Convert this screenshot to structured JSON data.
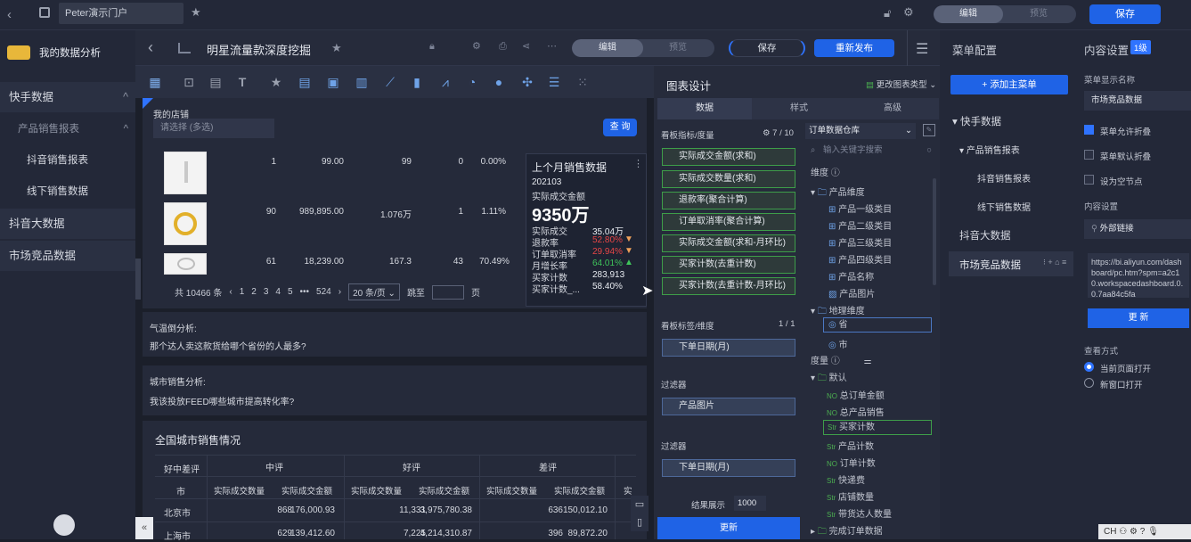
{
  "topbar": {
    "portal_name": "Peter演示门户",
    "mode_edit": "编辑",
    "mode_preview": "预览",
    "save": "保存"
  },
  "sidebar": {
    "title": "我的数据分析",
    "items": [
      {
        "label": "快手数据"
      },
      {
        "label": "产品销售报表"
      },
      {
        "label": "抖音销售报表"
      },
      {
        "label": "线下销售数据"
      },
      {
        "label": "抖音大数据"
      },
      {
        "label": "市场竞品数据"
      }
    ]
  },
  "dashboard": {
    "title": "明星流量款深度挖掘",
    "mode_edit": "编辑",
    "mode_preview": "预览",
    "save": "保存",
    "republish": "重新发布"
  },
  "filter": {
    "label": "我的店铺",
    "placeholder": "请选择 (多选)",
    "query": "查 询"
  },
  "products": [
    {
      "qty": "1",
      "amount": "99.00",
      "count": "99",
      "a": "0",
      "rate": "0.00%"
    },
    {
      "qty": "90",
      "amount": "989,895.00",
      "count": "1.076万",
      "a": "1",
      "rate": "1.11%"
    },
    {
      "qty": "61",
      "amount": "18,239.00",
      "count": "167.3",
      "a": "43",
      "rate": "70.49%"
    }
  ],
  "pager": {
    "total": "共 10466 条",
    "pages": [
      "1",
      "2",
      "3",
      "4",
      "5",
      "•••",
      "524"
    ],
    "per_page": "20 条/页",
    "jump": "跳至",
    "page_unit": "页"
  },
  "kpi": {
    "title": "上个月销售数据",
    "period": "202103",
    "main_label": "实际成交金额",
    "main_value": "9350万",
    "rows": [
      {
        "label": "实际成交...",
        "value": "35.04万",
        "arrow": ""
      },
      {
        "label": "退款率",
        "value": "52.80%",
        "arrow": "down"
      },
      {
        "label": "订单取消率",
        "value": "29.94%",
        "arrow": "down"
      },
      {
        "label": "月增长率",
        "value": "64.01%",
        "arrow": "up"
      },
      {
        "label": "买家计数",
        "value": "283,913",
        "arrow": ""
      },
      {
        "label": "买家计数_...",
        "value": "58.40%",
        "arrow": ""
      }
    ]
  },
  "analysis1": {
    "title": "气温倒分析:",
    "text": "那个达人卖这款货给哪个省份的人最多?"
  },
  "analysis2": {
    "title": "城市销售分析:",
    "text": "我该投放FEED哪些城市提高转化率?"
  },
  "city_table": {
    "title": "全国城市销售情况",
    "group_header": "好中差评",
    "groups": [
      "中评",
      "好评",
      "差评"
    ],
    "city_header": "市",
    "sub_headers": [
      "实际成交数量",
      "实际成交金额",
      "实际成交数量",
      "实际成交金额",
      "实际成交数量",
      "实际成交金额",
      "实"
    ],
    "rows": [
      {
        "city": "北京市",
        "v": [
          "868",
          "176,000.93",
          "11,331",
          "3,975,780.38",
          "636",
          "150,012.10"
        ]
      },
      {
        "city": "上海市",
        "v": [
          "629",
          "139,412.60",
          "7,225",
          "4,214,310.87",
          "396",
          "89,872.20"
        ]
      }
    ]
  },
  "design": {
    "title": "图表设计",
    "change_type": "更改图表类型",
    "tabs": [
      "数据",
      "样式",
      "高级"
    ],
    "indicator_label": "看板指标/度量",
    "indicator_count": "7 / 10",
    "indicators": [
      "实际成交金额(求和)",
      "实际成交数量(求和)",
      "退款率(聚合计算)",
      "订单取消率(聚合计算)",
      "实际成交金额(求和-月环比)",
      "买家计数(去重计数)",
      "买家计数(去重计数-月环比)"
    ],
    "dimension_label": "看板标签/维度",
    "dimension_count": "1 / 1",
    "dimension": "下单日期(月)",
    "filter1_label": "过滤器",
    "filter1": "产品图片",
    "filter2_label": "过滤器",
    "filter2": "下单日期(月)",
    "result_label": "结果展示",
    "result_value": "1000",
    "update": "更新"
  },
  "dataset": {
    "name": "订单数据仓库",
    "search_placeholder": "输入关键字搜索",
    "dim_label": "维度",
    "dim_folders": [
      {
        "name": "产品维度",
        "fields": [
          "产品一级类目",
          "产品二级类目",
          "产品三级类目",
          "产品四级类目",
          "产品名称",
          "产品图片"
        ]
      },
      {
        "name": "地理维度",
        "fields": [
          "省",
          "市"
        ]
      }
    ],
    "measure_label": "度量",
    "measure_folder": "默认",
    "measures": [
      {
        "tag": "NO",
        "name": "总订单金额"
      },
      {
        "tag": "NO",
        "name": "总产品销售"
      },
      {
        "tag": "Str",
        "name": "买家计数"
      },
      {
        "tag": "Str",
        "name": "产品计数"
      },
      {
        "tag": "NO",
        "name": "订单计数"
      },
      {
        "tag": "Str",
        "name": "快递费"
      },
      {
        "tag": "Str",
        "name": "店铺数量"
      },
      {
        "tag": "Str",
        "name": "带货达人数量"
      }
    ],
    "bottom_folder": "完成订单数据"
  },
  "menu_config": {
    "title": "菜单配置",
    "add_main": "+ 添加主菜单",
    "items": [
      {
        "label": "快手数据"
      },
      {
        "label": "产品销售报表"
      },
      {
        "label": "抖音销售报表"
      },
      {
        "label": "线下销售数据"
      },
      {
        "label": "抖音大数据"
      },
      {
        "label": "市场竞品数据"
      }
    ]
  },
  "content_settings": {
    "title": "内容设置",
    "level": "1级",
    "name_label": "菜单显示名称",
    "name_value": "市场竞品数据",
    "opt1": "菜单允许折叠",
    "opt2": "菜单默认折叠",
    "opt3": "设为空节点",
    "content_label": "内容设置",
    "content_type": "外部链接",
    "url": "https://bi.aliyun.com/dashboard/pc.htm?spm=a2c10.workspacedashboard.0.0.7aa84c5fa",
    "update": "更 新",
    "view_label": "查看方式",
    "view1": "当前页面打开",
    "view2": "新窗口打开"
  },
  "taskbar": {
    "lang": "CH"
  }
}
